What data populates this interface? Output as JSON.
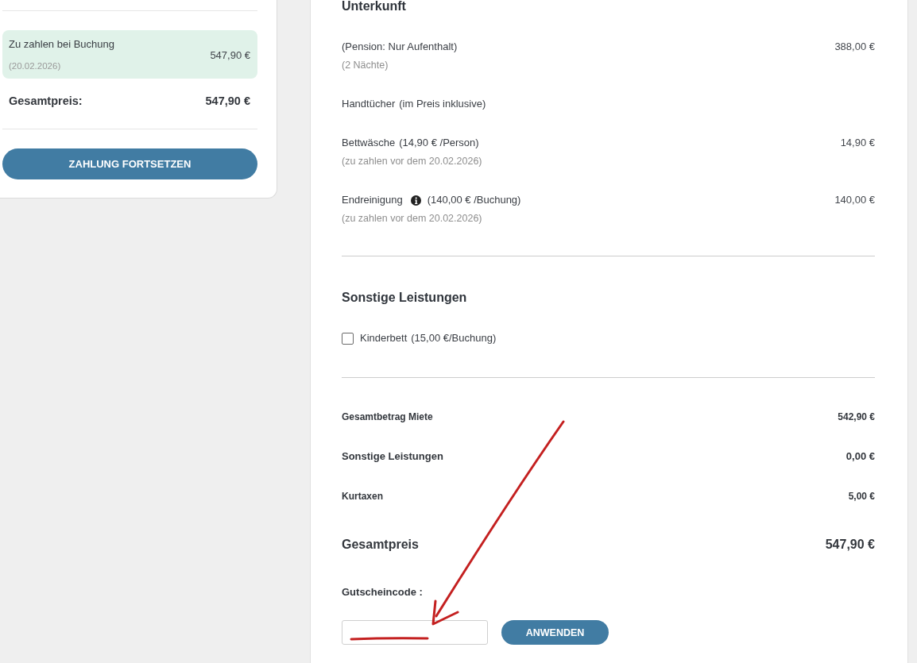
{
  "summary": {
    "due": {
      "label": "Zu zahlen bei Buchung",
      "date": "(20.02.2026)",
      "amount": "547,90 €"
    },
    "total": {
      "label": "Gesamtpreis:",
      "amount": "547,90 €"
    },
    "button": "ZAHLUNG FORTSETZEN"
  },
  "accommodation": {
    "title": "Unterkunft",
    "items": [
      {
        "name": "(Pension: Nur Aufenthalt)",
        "info_icon": false,
        "note": "(2 Nächte)",
        "amount": "388,00 €"
      },
      {
        "name": "Handtücher",
        "info_icon": false,
        "rate": "(im Preis inklusive)"
      },
      {
        "name": "Bettwäsche",
        "info_icon": false,
        "rate": "(14,90 € /Person)",
        "note": "(zu zahlen vor dem 20.02.2026)",
        "amount": "14,90 €"
      },
      {
        "name": "Endreinigung",
        "info_icon": true,
        "rate": "(140,00 € /Buchung)",
        "note": "(zu zahlen vor dem 20.02.2026)",
        "amount": "140,00 €"
      }
    ]
  },
  "extras": {
    "title": "Sonstige Leistungen",
    "options": [
      {
        "name": "Kinderbett",
        "rate": "(15,00 €/Buchung)",
        "checked": false
      }
    ]
  },
  "totals": [
    {
      "kind": "line",
      "label": "Gesamtbetrag Miete",
      "amount": "542,90 €"
    },
    {
      "kind": "strong",
      "label": "Sonstige Leistungen",
      "amount": "0,00 €"
    },
    {
      "kind": "line",
      "label": "Kurtaxen",
      "amount": "5,00 €"
    },
    {
      "kind": "grand",
      "label": "Gesamtpreis",
      "amount": "547,90 €"
    }
  ],
  "voucher": {
    "label": "Gutscheincode :",
    "button": "ANWENDEN"
  }
}
